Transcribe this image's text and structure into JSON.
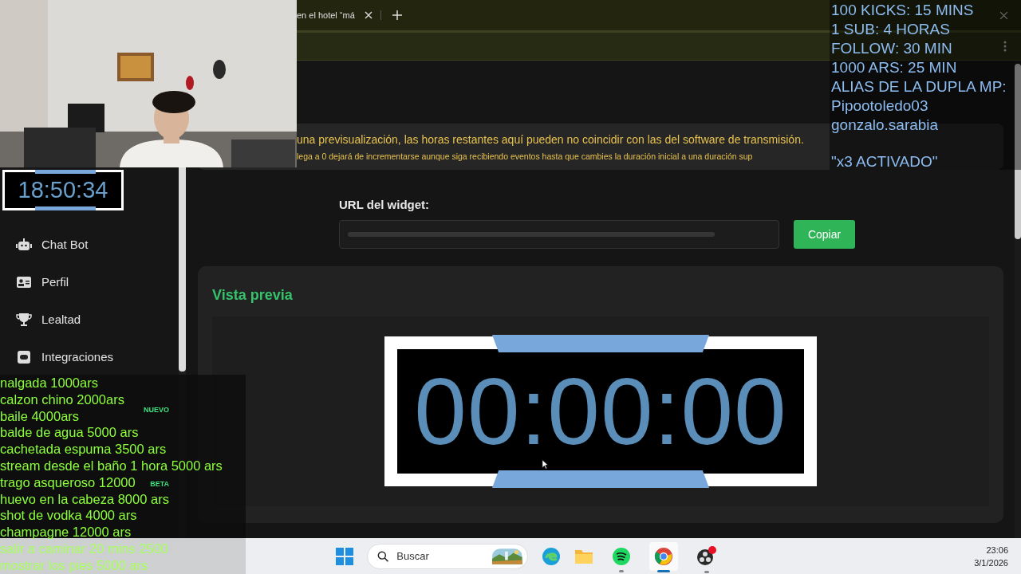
{
  "browser": {
    "tabs": [
      {
        "label": "en el hotel “má",
        "selected": true
      }
    ]
  },
  "notice": {
    "lines": [
      "una previsualización, las horas restantes aquí pueden no coincidir con las del software de transmisión.",
      "lega a 0 dejará de incrementarse aunque siga recibiendo eventos hasta que cambies la duración inicial a una duración sup"
    ]
  },
  "sidebar": {
    "items": [
      {
        "label": "Chat Bot"
      },
      {
        "label": "Perfil"
      },
      {
        "label": "Lealtad"
      },
      {
        "label": "Integraciones"
      }
    ],
    "badges": [
      {
        "label": "NUEVO"
      },
      {
        "label": "BETA"
      }
    ]
  },
  "widget": {
    "url_label": "URL del widget:",
    "copy_button": "Copiar"
  },
  "preview": {
    "title": "Vista previa",
    "timer": "00:00:00"
  },
  "taskbar": {
    "search_placeholder": "Buscar",
    "time": "23:06",
    "date": "3/1/2026"
  },
  "overlays": {
    "stream_timer": "18:50:34",
    "price_list": [
      "nalgada 1000ars",
      "calzon chino 2000ars",
      "baile 4000ars",
      "balde de agua 5000 ars",
      "cachetada espuma 3500 ars",
      "stream desde el baño 1 hora 5000 ars",
      "trago asqueroso 12000",
      "huevo en la cabeza 8000 ars",
      "shot de vodka 4000 ars",
      "champagne 12000 ars",
      "salir a caminar 20 mins 2500",
      "mostrar los pies 5000 ars"
    ],
    "info_lines": [
      "100 KICKS: 15 MINS",
      "1 SUB: 4 HORAS",
      "FOLLOW: 30 MIN",
      "1000 ARS: 25 MIN",
      "ALIAS DE LA DUPLA MP:",
      "Pipootoledo03",
      "gonzalo.sarabia"
    ],
    "activated_note": "\"x3 ACTIVADO\""
  }
}
